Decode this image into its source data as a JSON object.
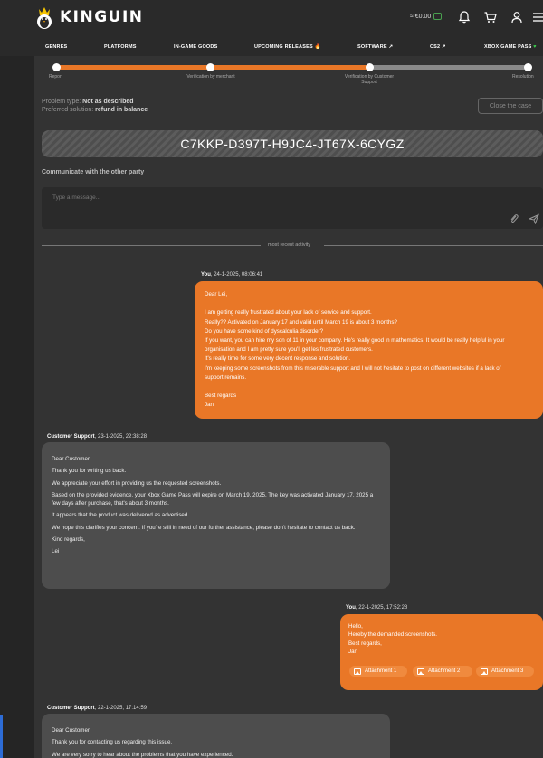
{
  "brand": {
    "name": "KINGUIN"
  },
  "header": {
    "wallet_amount": "≈ €0.00"
  },
  "nav": {
    "genres": "GENRES",
    "platforms": "PLATFORMS",
    "in_game_goods": "IN-GAME GOODS",
    "upcoming_releases": "UPCOMING RELEASES 🔥",
    "software": "SOFTWARE",
    "cs2": "CS2",
    "xbox_game_pass": "XBOX GAME PASS"
  },
  "progress": {
    "steps": [
      "Report",
      "Verification by merchant",
      "Verification by Customer Support",
      "Resolution"
    ],
    "completed_fraction": 0.66
  },
  "problem": {
    "type_label": "Problem type:",
    "type_value": "Not as described",
    "solution_label": "Preferred solution:",
    "solution_value": "refund in balance"
  },
  "close_case_label": "Close the case",
  "product_key": "C7KKP-D397T-H9JC4-JT67X-6CYGZ",
  "communicate": {
    "title": "Communicate with the other party",
    "placeholder": "Type a message..."
  },
  "divider_label": "most recent activity",
  "messages": [
    {
      "author": "You",
      "timestamp": ", 24-1-2025, 08:06:41",
      "lines": [
        "Dear Lei,",
        "",
        "I am getting really frustrated about your lack of service and support.",
        "Really?? Activated on January 17 and valid until March 19 is about 3 months?",
        "Do you have some kind of dyscalculia disorder?",
        "If you want, you can hire my son of 11 in your company. He's really good in mathematics. It would be really helpful in your",
        "organisation and I am pretty sure you'll get les frustrated customers.",
        "It's really time for some very decent response and solution.",
        "I'm keeping some screenshots from this miserable support and I will not hesitate to post on different websites if a lack of",
        "support remains.",
        "",
        "Best regards",
        "Jan"
      ]
    },
    {
      "author": "Customer Support",
      "timestamp": ", 23-1-2025, 22:38:28",
      "paragraphs": [
        "Dear Customer,",
        "Thank you for writing us back.",
        "We appreciate your effort in providing us the requested screenshots.",
        "Based on the provided evidence, your Xbox Game Pass will expire on March 19, 2025. The key was activated January 17, 2025 a few days after purchase, that's about 3 months.",
        "It appears that the product was delivered as advertised.",
        "We hope this clarifies your concern. If you're still in need of our further assistance, please don't hesitate to contact us back.",
        "Kind regards,",
        "Lei"
      ]
    },
    {
      "author": "You",
      "timestamp": ", 22-1-2025, 17:52:28",
      "lines": [
        "Hello,",
        "Hereby the demanded screenshots.",
        "Best regards,",
        "Jan"
      ],
      "attachments": [
        "Attachment 1",
        "Attachment 2",
        "Attachment 3"
      ]
    },
    {
      "author": "Customer Support",
      "timestamp": ", 22-1-2025, 17:14:59",
      "paragraphs": [
        "Dear Customer,",
        "Thank you for contacting us regarding this issue.",
        "We are very sorry to hear about the problems that you have experienced."
      ]
    }
  ]
}
